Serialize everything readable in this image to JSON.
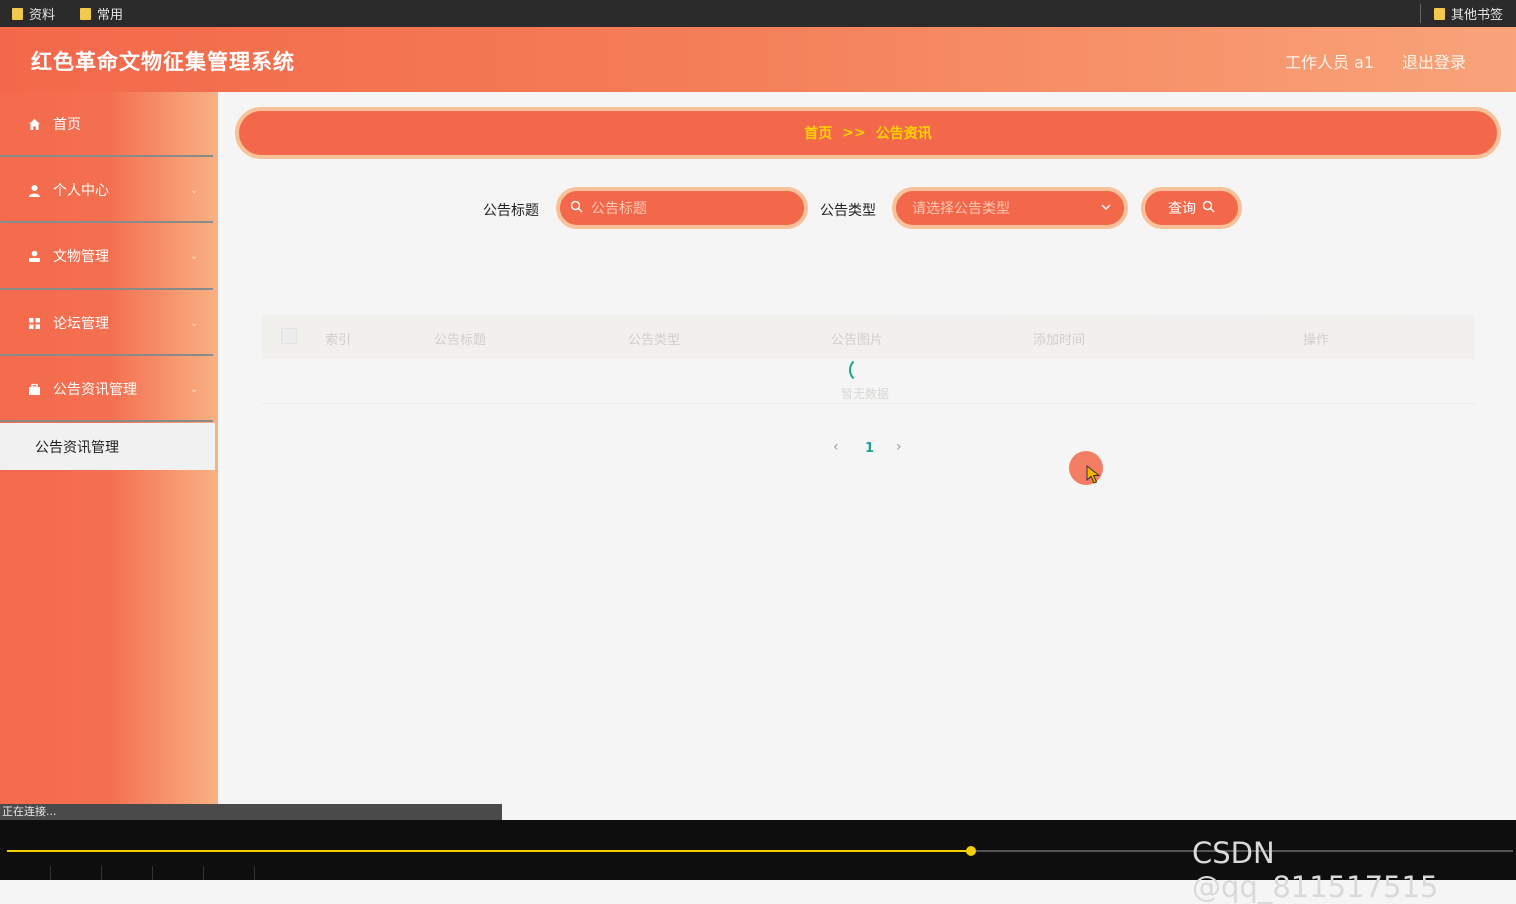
{
  "bookmarks": {
    "items": [
      "资料",
      "常用"
    ],
    "other": "其他书签"
  },
  "header": {
    "title": "红色革命文物征集管理系统",
    "user": "工作人员 a1",
    "logout": "退出登录"
  },
  "sidebar": {
    "items": [
      {
        "label": "首页",
        "icon": "home-icon"
      },
      {
        "label": "个人中心",
        "icon": "user-icon"
      },
      {
        "label": "文物管理",
        "icon": "person-icon"
      },
      {
        "label": "论坛管理",
        "icon": "grid-icon"
      },
      {
        "label": "公告资讯管理",
        "icon": "briefcase-icon"
      }
    ],
    "submenu": "公告资讯管理"
  },
  "breadcrumb": {
    "home": "首页",
    "separator": ">>",
    "current": "公告资讯"
  },
  "search": {
    "title_label": "公告标题",
    "title_placeholder": "公告标题",
    "type_label": "公告类型",
    "type_placeholder": "请选择公告类型",
    "query_button": "查询"
  },
  "table": {
    "columns": [
      "索引",
      "公告标题",
      "公告类型",
      "公告图片",
      "添加时间",
      "操作"
    ],
    "loading_text": "暂无数据"
  },
  "pagination": {
    "current": "1"
  },
  "status": {
    "text": "正在连接..."
  },
  "player": {
    "progress": 0.64,
    "watermark": "CSDN @qq_811517515"
  },
  "colors": {
    "accent": "#f3674a",
    "border": "#f9c19a",
    "breadcrumb_text": "#ffd400",
    "spinner": "#1aa394"
  }
}
